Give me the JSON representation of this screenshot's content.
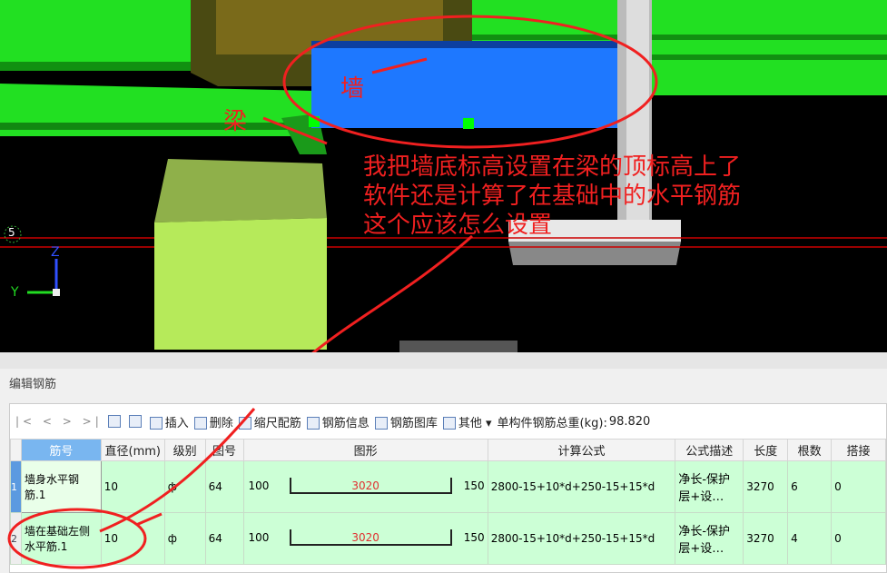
{
  "annotations": {
    "wall": "墙",
    "beam": "梁",
    "question": [
      "我把墙底标高设置在梁的顶标高上了",
      "软件还是计算了在基础中的水平钢筋",
      "这个应该怎么设置"
    ]
  },
  "axis": {
    "z": "Z",
    "y": "Y",
    "marker": "5"
  },
  "panel": {
    "title": "编辑钢筋"
  },
  "toolbar": {
    "nav": "|< < > >|",
    "insert": "插入",
    "delete": "删除",
    "scale": "缩尺配筋",
    "info": "钢筋信息",
    "library": "钢筋图库",
    "other": "其他",
    "total_label": "单构件钢筋总重(kg):",
    "total_value": "98.820"
  },
  "columns": [
    "筋号",
    "直径(mm)",
    "级别",
    "图号",
    "图形",
    "计算公式",
    "公式描述",
    "长度",
    "根数",
    "搭接"
  ],
  "rows": [
    {
      "n": "1",
      "name": "墙身水平钢筋.1",
      "dia": "10",
      "grade": "ф",
      "fig": "64",
      "left": "100",
      "mid": "3020",
      "right": "150",
      "formula": "2800-15+10*d+250-15+15*d",
      "desc": "净长-保护层+设…",
      "len": "3270",
      "count": "6",
      "lap": "0"
    },
    {
      "n": "2",
      "name": "墙在基础左侧水平筋.1",
      "dia": "10",
      "grade": "ф",
      "fig": "64",
      "left": "100",
      "mid": "3020",
      "right": "150",
      "formula": "2800-15+10*d+250-15+15*d",
      "desc": "净长-保护层+设…",
      "len": "3270",
      "count": "4",
      "lap": "0"
    }
  ],
  "colors": {
    "model_green": "#22e022",
    "wall_blue": "#1e78ff",
    "annotation_red": "#f02020",
    "row_green": "#ccffd6",
    "header_selected": "#79b6f0"
  }
}
